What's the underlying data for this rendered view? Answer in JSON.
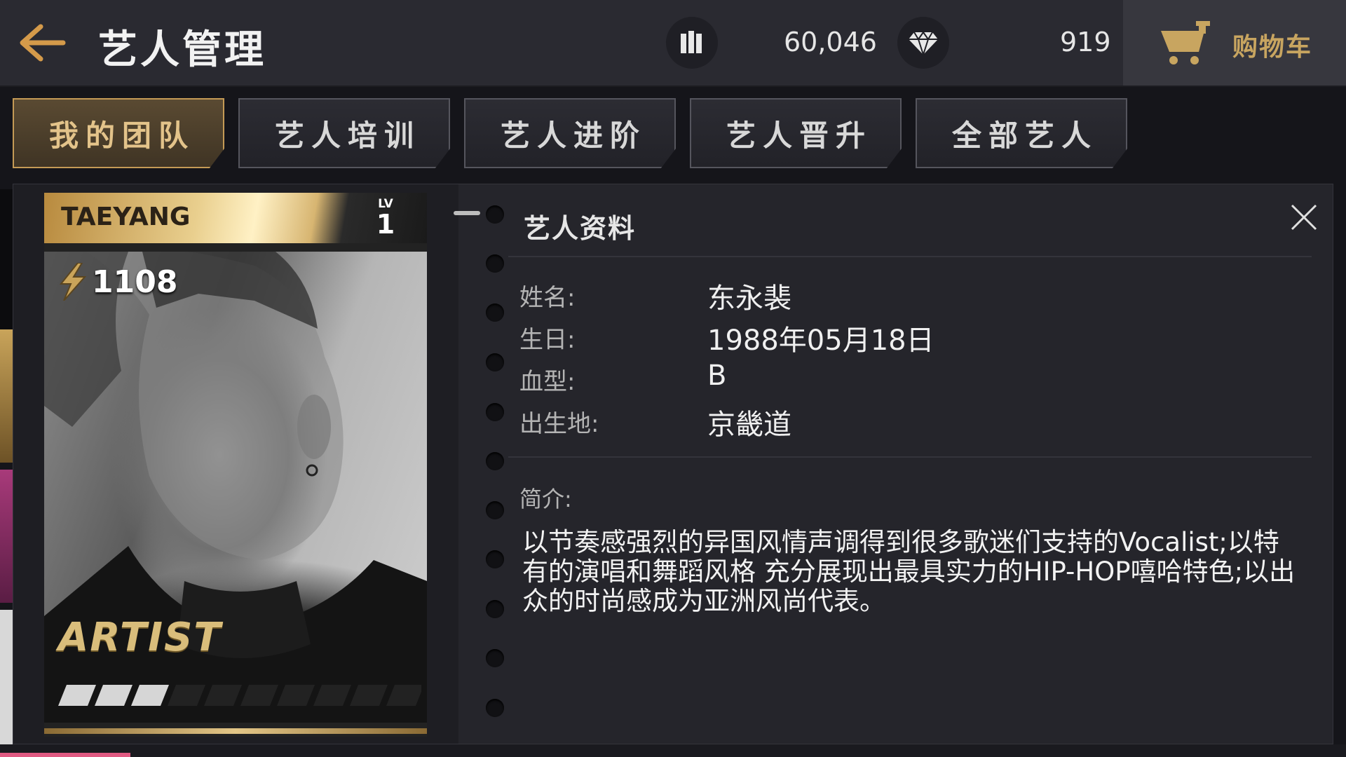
{
  "header": {
    "title": "艺人管理",
    "resources": [
      {
        "icon": "bars-icon",
        "value": "60,046"
      },
      {
        "icon": "diamond-icon",
        "value": "919"
      }
    ],
    "cart_label": "购物车"
  },
  "tabs": [
    {
      "label": "我的团队",
      "active": true
    },
    {
      "label": "艺人培训",
      "active": false
    },
    {
      "label": "艺人进阶",
      "active": false
    },
    {
      "label": "艺人晋升",
      "active": false
    },
    {
      "label": "全部艺人",
      "active": false
    }
  ],
  "card": {
    "name": "TAEYANG",
    "level_label": "LV",
    "level": "1",
    "power": "1108",
    "rank_logo": "ARTIST",
    "star_rating": 3,
    "star_max": 10
  },
  "info": {
    "title": "艺人资料",
    "fields": [
      {
        "label": "姓名:",
        "value": "东永裴"
      },
      {
        "label": "生日:",
        "value": "1988年05月18日"
      },
      {
        "label": "血型:",
        "value": "B"
      },
      {
        "label": "出生地:",
        "value": "京畿道"
      }
    ],
    "description_label": "简介:",
    "description": "以节奏感强烈的异国风情声调得到很多歌迷们支持的Vocalist;以特有的演唱和舞蹈风格 充分展现出最具实力的HIP-HOP嘻哈特色;以出众的时尚感成为亚洲风尚代表。"
  },
  "colors": {
    "accent_gold": "#c8a560",
    "panel_bg": "#25252b",
    "topbar_bg": "#2a2a31"
  }
}
